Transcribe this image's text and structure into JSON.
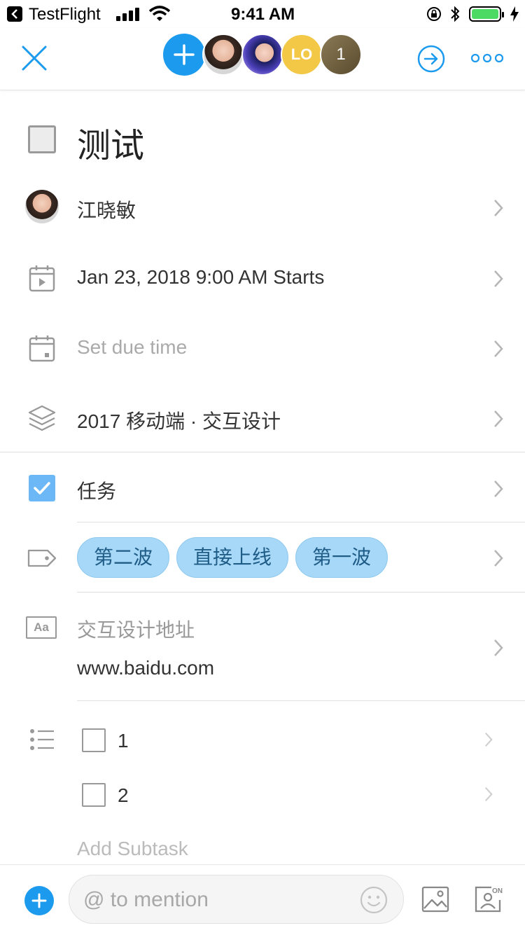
{
  "status_bar": {
    "carrier": "TestFlight",
    "time": "9:41 AM"
  },
  "nav": {
    "close_icon": "close-icon",
    "add_member_icon": "plus-icon",
    "members": [
      {
        "type": "photo",
        "name": "member-avatar-1"
      },
      {
        "type": "photo",
        "name": "member-avatar-2"
      },
      {
        "type": "initials",
        "label": "LO"
      },
      {
        "type": "count",
        "label": "1"
      }
    ],
    "share_icon": "arrow-circle-right-icon",
    "more_icon": "more-dots-icon",
    "accent_color": "#1b9aee"
  },
  "task": {
    "title": "测试",
    "assignee": "江晓敏",
    "start_time": "Jan 23, 2018 9:00 AM Starts",
    "due_placeholder": "Set due time",
    "project": "2017 移动端 · 交互设计",
    "task_type": "任务",
    "tags": [
      "第二波",
      "直接上线",
      "第一波"
    ],
    "custom_field": {
      "label": "交互设计地址",
      "value": "www.baidu.com"
    },
    "subtasks": [
      {
        "label": "1",
        "done": false
      },
      {
        "label": "2",
        "done": false
      }
    ],
    "add_subtask": "Add Subtask"
  },
  "comment_bar": {
    "placeholder": "@ to mention",
    "image_icon": "image-icon",
    "emoji_icon": "emoji-icon",
    "contact_icon": "contact-card-icon"
  }
}
